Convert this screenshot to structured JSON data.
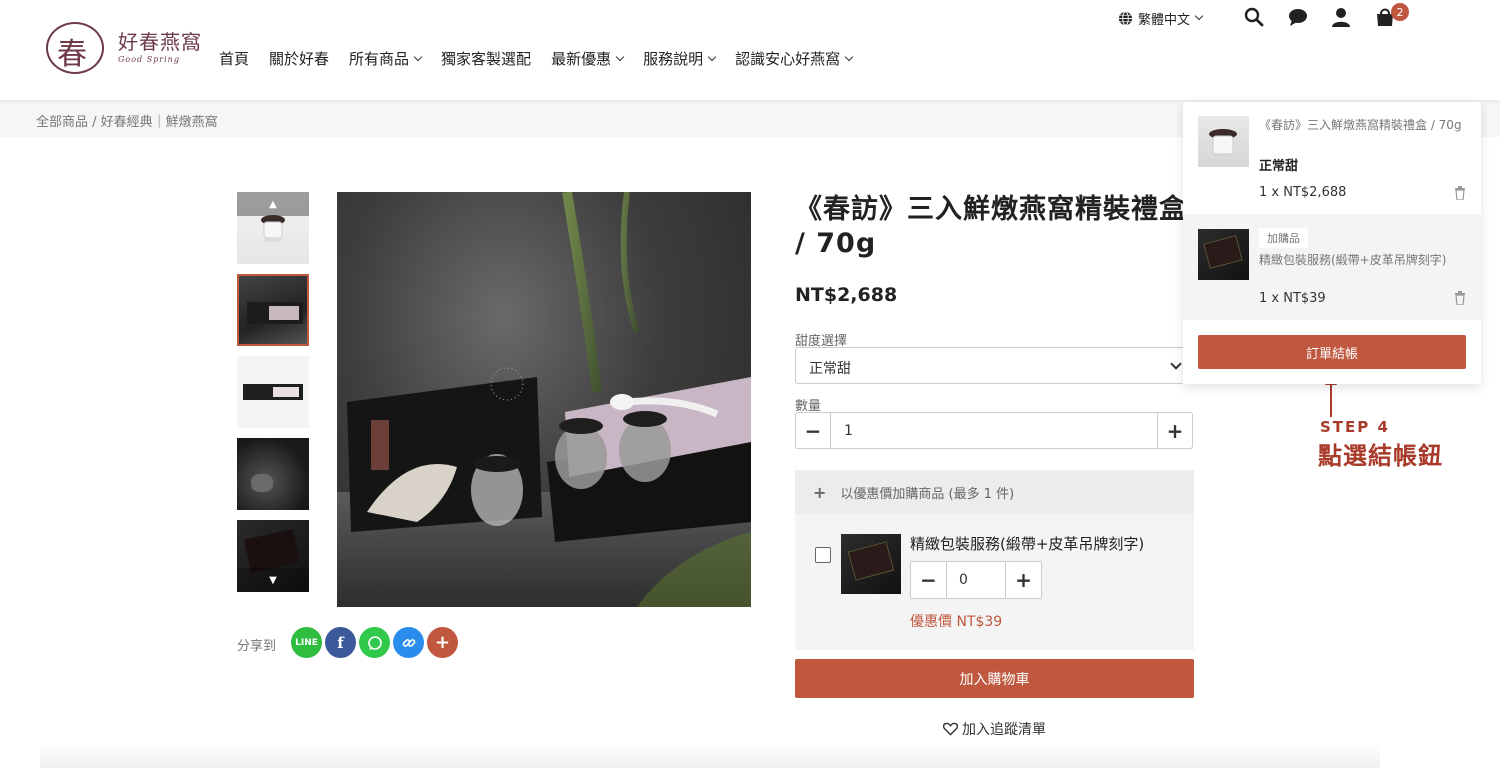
{
  "logo": {
    "mark": "春",
    "chinese": "好春燕窩",
    "english": "Good Spring"
  },
  "nav": [
    {
      "label": "首頁",
      "dropdown": false
    },
    {
      "label": "關於好春",
      "dropdown": false
    },
    {
      "label": "所有商品",
      "dropdown": true
    },
    {
      "label": "獨家客製選配",
      "dropdown": false
    },
    {
      "label": "最新優惠",
      "dropdown": true
    },
    {
      "label": "服務說明",
      "dropdown": true
    },
    {
      "label": "認識安心好燕窩",
      "dropdown": true
    }
  ],
  "topbar": {
    "language": "繁體中文",
    "cart_count": "2"
  },
  "breadcrumb": "全部商品 / 好春經典｜鮮燉燕窩",
  "product": {
    "title": "《春訪》三入鮮燉燕窩精裝禮盒 / 70g",
    "price": "NT$2,688",
    "sweetness_label": "甜度選擇",
    "sweetness_value": "正常甜",
    "quantity_label": "數量",
    "quantity_value": "1"
  },
  "addon": {
    "header": "以優惠價加購商品 (最多 1 件)",
    "name": "精緻包裝服務(緞帶+皮革吊牌刻字)",
    "quantity": "0",
    "price": "優惠價 NT$39"
  },
  "buttons": {
    "add_to_cart": "加入購物車",
    "wishlist": "加入追蹤清單"
  },
  "share": {
    "label": "分享到",
    "buttons": [
      "line",
      "facebook",
      "whatsapp",
      "copy-link",
      "more"
    ]
  },
  "cart_panel": {
    "item1": {
      "name": "《春訪》三入鮮燉燕窩精裝禮盒 / 70g",
      "variant": "正常甜",
      "qty_price": "1 x  NT$2,688"
    },
    "item2": {
      "tag": "加購品",
      "name": "精緻包裝服務(緞帶+皮革吊牌刻字)",
      "qty_price": "1 x  NT$39"
    },
    "checkout": "訂單結帳"
  },
  "annotation": {
    "step": "STEP 4",
    "text": "點選結帳鈕"
  },
  "colors": {
    "accent": "#c0583f",
    "brand": "#6e3a48",
    "annotation": "#a83a2a",
    "line": "#2ebd3e",
    "facebook": "#3b5998",
    "whatsapp": "#30c94c",
    "link": "#2a8ded"
  }
}
